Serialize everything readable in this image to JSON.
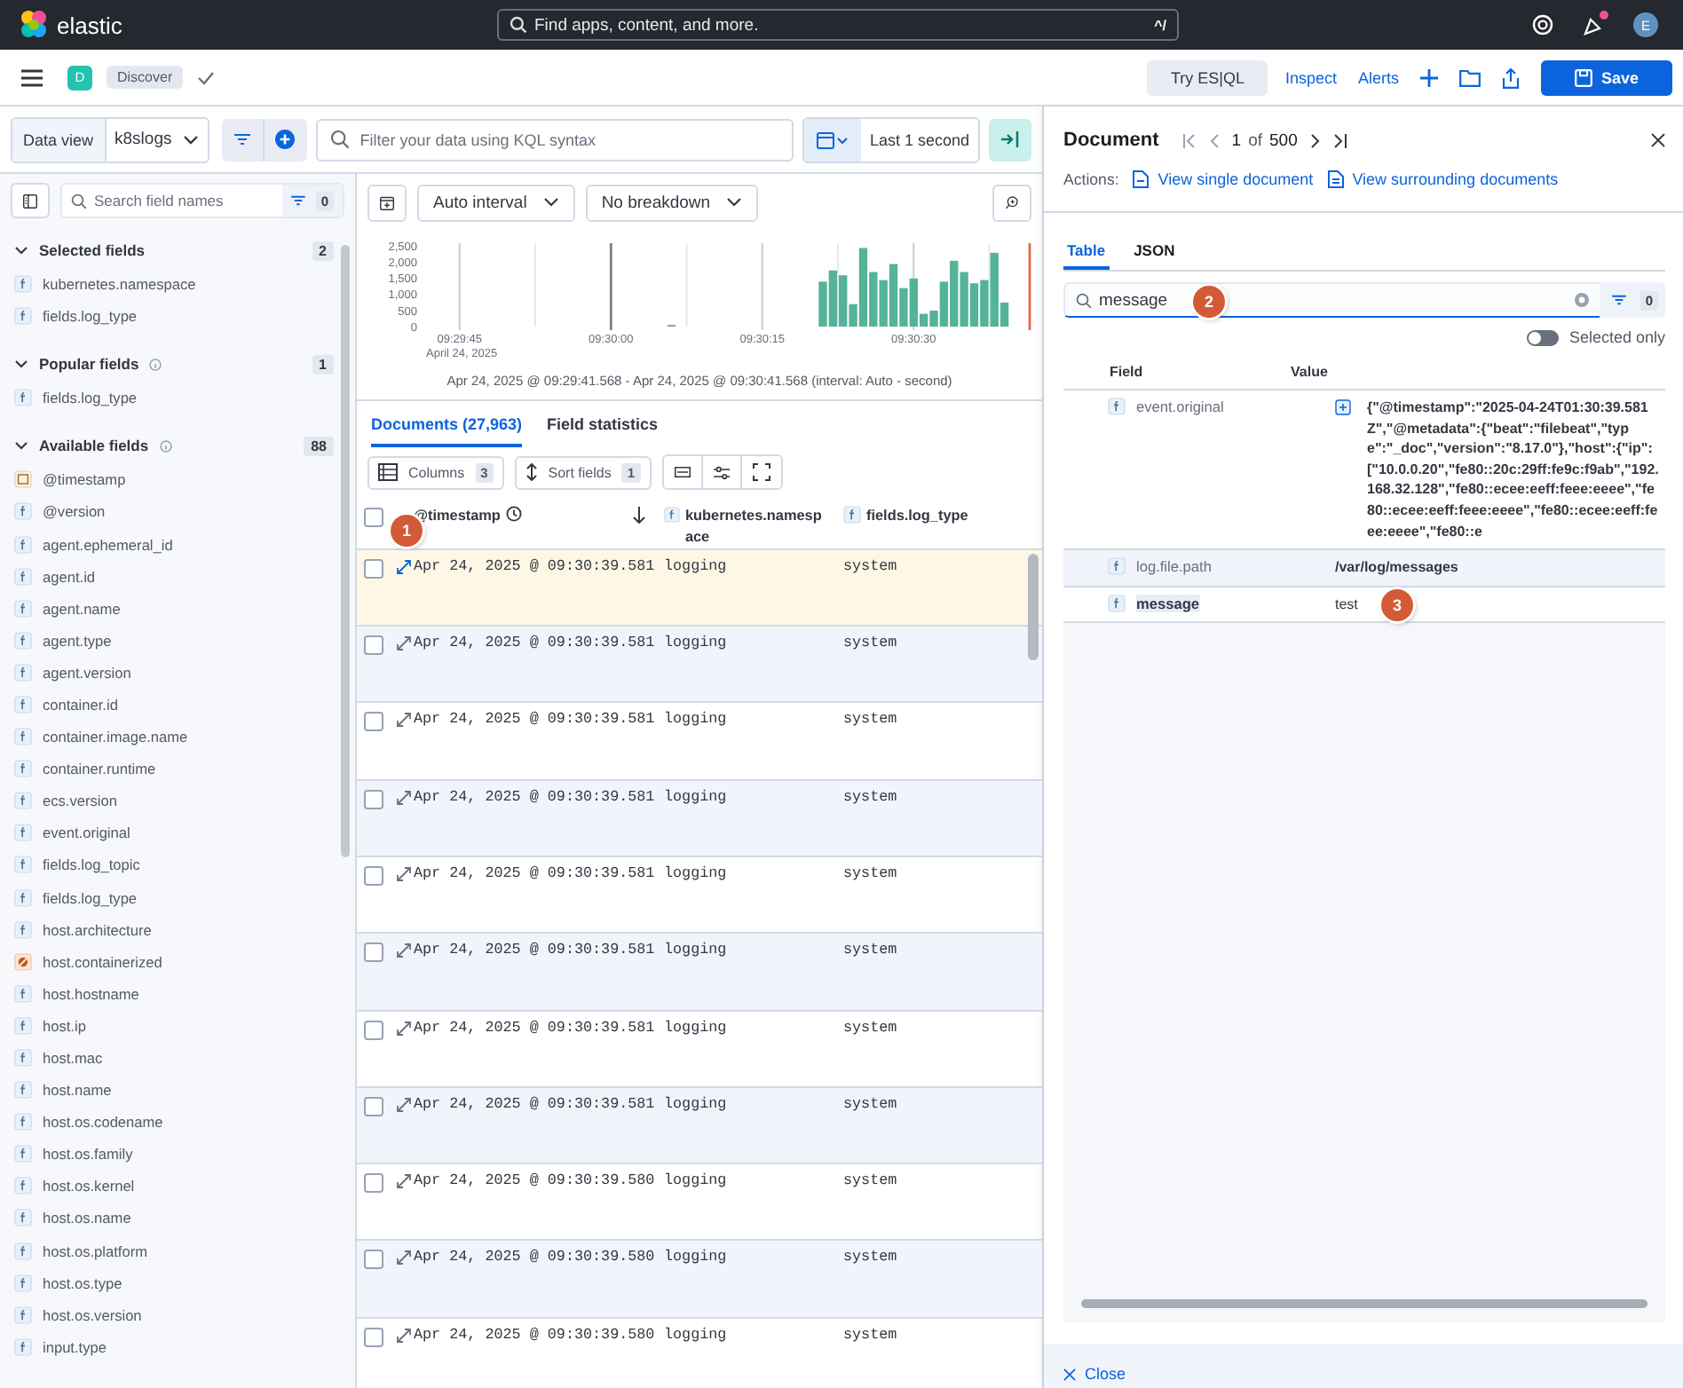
{
  "topbar": {
    "logo": "elastic",
    "search_placeholder": "Find apps, content, and more.",
    "shortcut": "^/",
    "news_unread": true,
    "avatar": "E"
  },
  "appbar": {
    "app_badge": "D",
    "breadcrumb": "Discover",
    "actions": [
      {
        "label": "Try ES|QL",
        "kind": "secondary"
      },
      {
        "label": "Inspect",
        "kind": "link"
      },
      {
        "label": "Alerts",
        "kind": "link"
      }
    ],
    "save": "Save"
  },
  "query": {
    "data_view_label": "Data view",
    "data_view": "k8slogs",
    "placeholder": "Filter your data using KQL syntax",
    "time_range": "Last 1 second"
  },
  "sidebar": {
    "search_placeholder": "Search field names",
    "filter_count": "0",
    "sections": [
      {
        "title": "Selected fields",
        "count": "2",
        "expanded": true,
        "help": false,
        "fields": [
          {
            "name": "kubernetes.namespace",
            "kind": "string"
          },
          {
            "name": "fields.log_type",
            "kind": "string"
          }
        ]
      },
      {
        "title": "Popular fields",
        "count": "1",
        "expanded": true,
        "help": true,
        "fields": [
          {
            "name": "fields.log_type",
            "kind": "string"
          }
        ]
      },
      {
        "title": "Available fields",
        "count": "88",
        "expanded": true,
        "help": true,
        "fields": [
          {
            "name": "@timestamp",
            "kind": "date"
          },
          {
            "name": "@version",
            "kind": "string"
          },
          {
            "name": "agent.ephemeral_id",
            "kind": "string"
          },
          {
            "name": "agent.id",
            "kind": "string"
          },
          {
            "name": "agent.name",
            "kind": "string"
          },
          {
            "name": "agent.type",
            "kind": "string"
          },
          {
            "name": "agent.version",
            "kind": "string"
          },
          {
            "name": "container.id",
            "kind": "string"
          },
          {
            "name": "container.image.name",
            "kind": "string"
          },
          {
            "name": "container.runtime",
            "kind": "string"
          },
          {
            "name": "ecs.version",
            "kind": "string"
          },
          {
            "name": "event.original",
            "kind": "string"
          },
          {
            "name": "fields.log_topic",
            "kind": "string"
          },
          {
            "name": "fields.log_type",
            "kind": "string"
          },
          {
            "name": "host.architecture",
            "kind": "string"
          },
          {
            "name": "host.containerized",
            "kind": "boolean"
          },
          {
            "name": "host.hostname",
            "kind": "string"
          },
          {
            "name": "host.ip",
            "kind": "string"
          },
          {
            "name": "host.mac",
            "kind": "string"
          },
          {
            "name": "host.name",
            "kind": "string"
          },
          {
            "name": "host.os.codename",
            "kind": "string"
          },
          {
            "name": "host.os.family",
            "kind": "string"
          },
          {
            "name": "host.os.kernel",
            "kind": "string"
          },
          {
            "name": "host.os.name",
            "kind": "string"
          },
          {
            "name": "host.os.platform",
            "kind": "string"
          },
          {
            "name": "host.os.type",
            "kind": "string"
          },
          {
            "name": "host.os.version",
            "kind": "string"
          },
          {
            "name": "input.type",
            "kind": "string"
          }
        ]
      }
    ]
  },
  "histogram": {
    "interval": "Auto interval",
    "breakdown": "No breakdown",
    "date_label": "April 24, 2025",
    "range_text": "Apr 24, 2025 @ 09:29:41.568 - Apr 24, 2025 @ 09:30:41.568 (interval: Auto - second)",
    "chart_data": {
      "type": "bar",
      "categories": [
        null,
        null,
        null,
        "09:29:45",
        null,
        null,
        null,
        null,
        null,
        null,
        null,
        null,
        null,
        null,
        null,
        null,
        null,
        null,
        "09:30:00",
        null,
        null,
        null,
        null,
        null,
        null,
        null,
        null,
        null,
        null,
        null,
        null,
        null,
        null,
        "09:30:15",
        null,
        null,
        null,
        null,
        null,
        null,
        null,
        null,
        null,
        null,
        null,
        null,
        null,
        null,
        "09:30:30",
        null,
        null,
        null,
        null,
        null,
        null,
        null,
        null,
        null,
        null,
        null
      ],
      "series": [
        {
          "color": "#54b399",
          "values": [
            null,
            null,
            null,
            null,
            null,
            null,
            null,
            null,
            null,
            null,
            null,
            null,
            null,
            null,
            null,
            null,
            null,
            null,
            null,
            null,
            null,
            null,
            null,
            null,
            50,
            null,
            null,
            null,
            null,
            null,
            null,
            null,
            null,
            null,
            null,
            null,
            null,
            null,
            null,
            1400,
            1750,
            1600,
            700,
            2450,
            1700,
            1450,
            1950,
            1200,
            1500,
            400,
            500,
            1400,
            2050,
            1700,
            1350,
            1450,
            2300,
            750,
            null,
            null
          ]
        }
      ],
      "ylim": [
        0,
        2600
      ],
      "grid": true,
      "yticks": [
        {
          "value": 0,
          "label": "0"
        },
        {
          "value": 500,
          "label": "500"
        },
        {
          "value": 1000,
          "label": "1,000"
        },
        {
          "value": 1500,
          "label": "1,500"
        },
        {
          "value": 2000,
          "label": "2,000"
        },
        {
          "value": 2500,
          "label": "2,500"
        }
      ]
    }
  },
  "tabs": [
    {
      "label": "Documents (27,963)",
      "selected": true
    },
    {
      "label": "Field statistics",
      "selected": false
    }
  ],
  "grid_toolbar": {
    "columns_label": "Columns",
    "columns_count": "3",
    "sort_label": "Sort fields",
    "sort_count": "1"
  },
  "table": {
    "all_checked": false,
    "header_callout": "1",
    "columns": [
      {
        "label": "@timestamp",
        "kind": "date"
      },
      {
        "label": "kubernetes.namespace",
        "kind": "string"
      },
      {
        "label": "fields.log_type",
        "kind": "string"
      }
    ],
    "rows": [
      {
        "cells": [
          "Apr 24, 2025 @ 09:30:39.581",
          "logging",
          "system"
        ],
        "selected": true,
        "checked": false
      },
      {
        "cells": [
          "Apr 24, 2025 @ 09:30:39.581",
          "logging",
          "system"
        ],
        "selected": false,
        "checked": false
      },
      {
        "cells": [
          "Apr 24, 2025 @ 09:30:39.581",
          "logging",
          "system"
        ],
        "selected": false,
        "checked": false
      },
      {
        "cells": [
          "Apr 24, 2025 @ 09:30:39.581",
          "logging",
          "system"
        ],
        "selected": false,
        "checked": false
      },
      {
        "cells": [
          "Apr 24, 2025 @ 09:30:39.581",
          "logging",
          "system"
        ],
        "selected": false,
        "checked": false
      },
      {
        "cells": [
          "Apr 24, 2025 @ 09:30:39.581",
          "logging",
          "system"
        ],
        "selected": false,
        "checked": false
      },
      {
        "cells": [
          "Apr 24, 2025 @ 09:30:39.581",
          "logging",
          "system"
        ],
        "selected": false,
        "checked": false
      },
      {
        "cells": [
          "Apr 24, 2025 @ 09:30:39.581",
          "logging",
          "system"
        ],
        "selected": false,
        "checked": false
      },
      {
        "cells": [
          "Apr 24, 2025 @ 09:30:39.580",
          "logging",
          "system"
        ],
        "selected": false,
        "checked": false
      },
      {
        "cells": [
          "Apr 24, 2025 @ 09:30:39.580",
          "logging",
          "system"
        ],
        "selected": false,
        "checked": false
      },
      {
        "cells": [
          "Apr 24, 2025 @ 09:30:39.580",
          "logging",
          "system"
        ],
        "selected": false,
        "checked": false
      }
    ]
  },
  "document": {
    "title": "Document",
    "page": "1",
    "of": "of",
    "total": "500",
    "actions_label": "Actions:",
    "actions": [
      "View single document",
      "View surrounding documents"
    ],
    "tabs": [
      {
        "label": "Table",
        "selected": true
      },
      {
        "label": "JSON",
        "selected": false
      }
    ],
    "search_value": "message",
    "search_callout": "2",
    "filter_count": "0",
    "selected_only": {
      "label": "Selected only",
      "on": false
    },
    "columns": [
      "Field",
      "Value"
    ],
    "rows": [
      {
        "field": "event.original",
        "kind": "json",
        "value": "{\"@timestamp\":\"2025-04-24T01:30:39.581Z\",\"@metadata\":{\"beat\":\"filebeat\",\"type\":\"_doc\",\"version\":\"8.17.0\"},\"host\":{\"ip\":[\"10.0.0.20\",\"fe80::20c:29ff:fe9c:f9ab\",\"192.168.32.128\",\"fe80::ecee:eeff:feee:eeee\",\"fe80::ecee:eeff:feee:eeee\",\"fe80::ecee:eeff:feee:eeee\",\"fe80::e",
        "hovered": false,
        "match": false
      },
      {
        "field": "log.file.path",
        "kind": "keyword",
        "value": "/var/log/messages",
        "hovered": true,
        "match": false
      },
      {
        "field": "message",
        "kind": "text",
        "value": "test",
        "hovered": false,
        "match": true,
        "callout": "3"
      }
    ],
    "close": "Close"
  }
}
